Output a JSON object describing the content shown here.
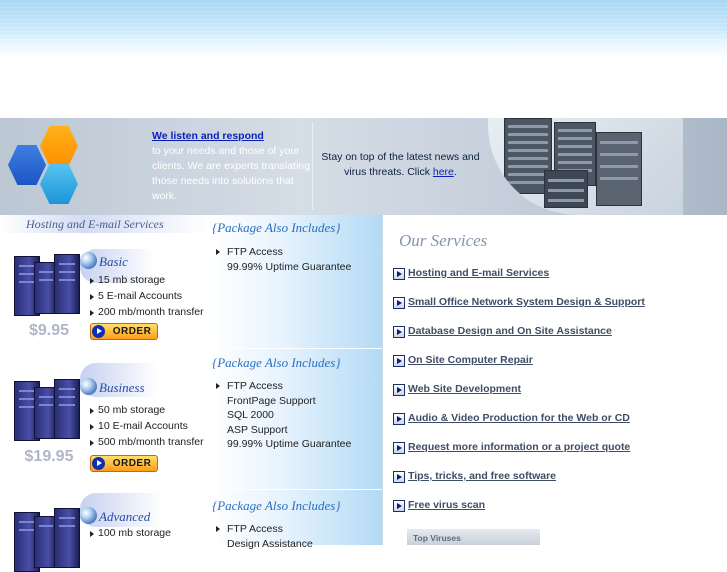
{
  "banner": {
    "heading": "We listen and respond",
    "body": "to your needs and those of your clients. We are experts translating those needs into solutions that work.",
    "news_text": "Stay on top of the latest news and virus threats. Click",
    "news_link": "here",
    "news_end": "."
  },
  "left_header": "Hosting and E-mail Services",
  "packages": [
    {
      "name": "Basic",
      "price": "$9.95",
      "features": [
        "15 mb storage",
        "5 E-mail Accounts",
        "200 mb/month transfer"
      ],
      "order_label": "ORDER"
    },
    {
      "name": "Business",
      "price": "$19.95",
      "features": [
        "50 mb storage",
        "10 E-mail Accounts",
        "500 mb/month transfer"
      ],
      "order_label": "ORDER"
    },
    {
      "name": "Advanced",
      "price": "",
      "features": [
        "100 mb storage"
      ],
      "order_label": ""
    }
  ],
  "includes": [
    {
      "title": "{Package Also Includes}",
      "items": [
        "FTP Access",
        "99.99% Uptime Guarantee"
      ]
    },
    {
      "title": "{Package Also Includes}",
      "items": [
        "FTP Access",
        "FrontPage Support",
        "SQL 2000",
        "ASP Support",
        "99.99% Uptime Guarantee"
      ]
    },
    {
      "title": "{Package Also Includes}",
      "items": [
        "FTP Access",
        "Design Assistance"
      ]
    }
  ],
  "services": {
    "title": "Our Services",
    "items": [
      "Hosting and E-mail Services",
      "Small Office Network System Design & Support",
      "Database Design and On Site Assistance",
      "On Site Computer Repair",
      "Web Site Development",
      "Audio & Video Production for the Web or CD",
      "Request more information or a project quote",
      "Tips, tricks, and free software",
      "Free virus scan"
    ]
  },
  "top_viruses_label": "Top Viruses",
  "colors": {
    "link_blue": "#0a1fb8",
    "order_orange": "#ff9d1b",
    "service_text": "#3f4d66"
  }
}
